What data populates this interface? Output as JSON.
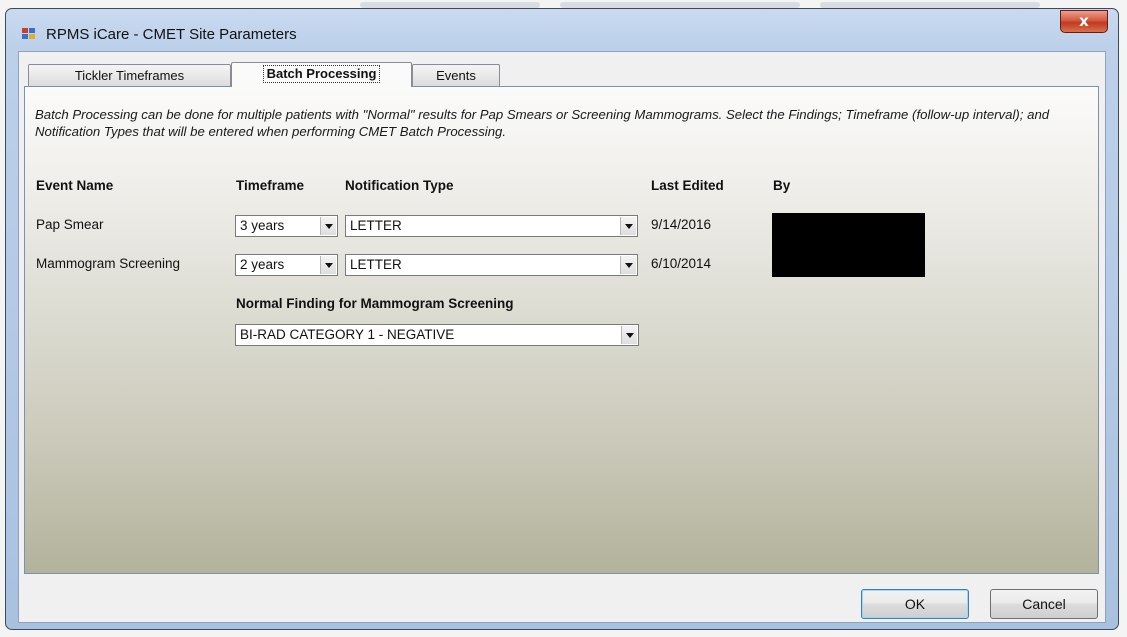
{
  "window": {
    "title": "RPMS iCare - CMET Site Parameters",
    "close_label": "x"
  },
  "tabs": [
    {
      "label": "Tickler Timeframes",
      "active": false
    },
    {
      "label": "Batch Processing",
      "active": true
    },
    {
      "label": "Events",
      "active": false
    }
  ],
  "description": "Batch Processing can be done for multiple patients with \"Normal\" results for Pap Smears or Screening Mammograms.  Select the Findings; Timeframe (follow-up interval); and Notification Types that will be entered when performing CMET Batch Processing.",
  "columns": {
    "event_name": "Event Name",
    "timeframe": "Timeframe",
    "notification_type": "Notification Type",
    "last_edited": "Last Edited",
    "by": "By"
  },
  "rows": [
    {
      "event": "Pap Smear",
      "timeframe": "3 years",
      "notification": "LETTER",
      "last_edited": "9/14/2016"
    },
    {
      "event": "Mammogram Screening",
      "timeframe": "2 years",
      "notification": "LETTER",
      "last_edited": "6/10/2014"
    }
  ],
  "normal_finding": {
    "label": "Normal Finding for Mammogram Screening",
    "value": "BI-RAD CATEGORY 1 - NEGATIVE"
  },
  "buttons": {
    "ok": "OK",
    "cancel": "Cancel"
  },
  "colors": {
    "titlebar": "#bcd0ea",
    "close_button": "#c03a1f",
    "redaction": "#000000"
  }
}
